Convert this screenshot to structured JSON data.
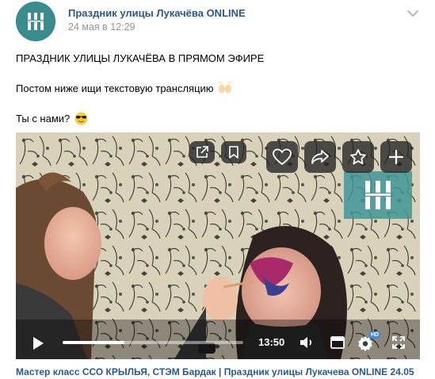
{
  "post": {
    "author": "Праздник улицы Лукачёва ONLINE",
    "date": "24 мая в 12:29",
    "lines": [
      "ПРАЗДНИК УЛИЦЫ ЛУКАЧЁВА В ПРЯМОМ ЭФИРЕ",
      "Постом ниже ищи текстовую трансляцию",
      "Ты с нами?"
    ],
    "emojis": [
      "raising-hands-emoji",
      "sunglasses-emoji"
    ]
  },
  "video": {
    "time": "13:50",
    "progress": 0.34,
    "hd_label": "HD",
    "title": "Мастер класс ССО КРЫЛЬЯ, СТЭМ Бардак | Праздник улицы Лукачева ONLINE 24.05",
    "overlay_icons": [
      "share-external-icon",
      "bookmark-icon",
      "heart-icon",
      "share-arrow-icon",
      "star-icon",
      "plus-icon"
    ],
    "control_icons": [
      "play-icon",
      "volume-icon",
      "miniplayer-icon",
      "settings-icon",
      "fullscreen-icon"
    ]
  },
  "colors": {
    "link": "#2a5885",
    "date": "#939393",
    "brand_teal": "#3b8c8c",
    "hd_badge": "#3f8ae0"
  }
}
